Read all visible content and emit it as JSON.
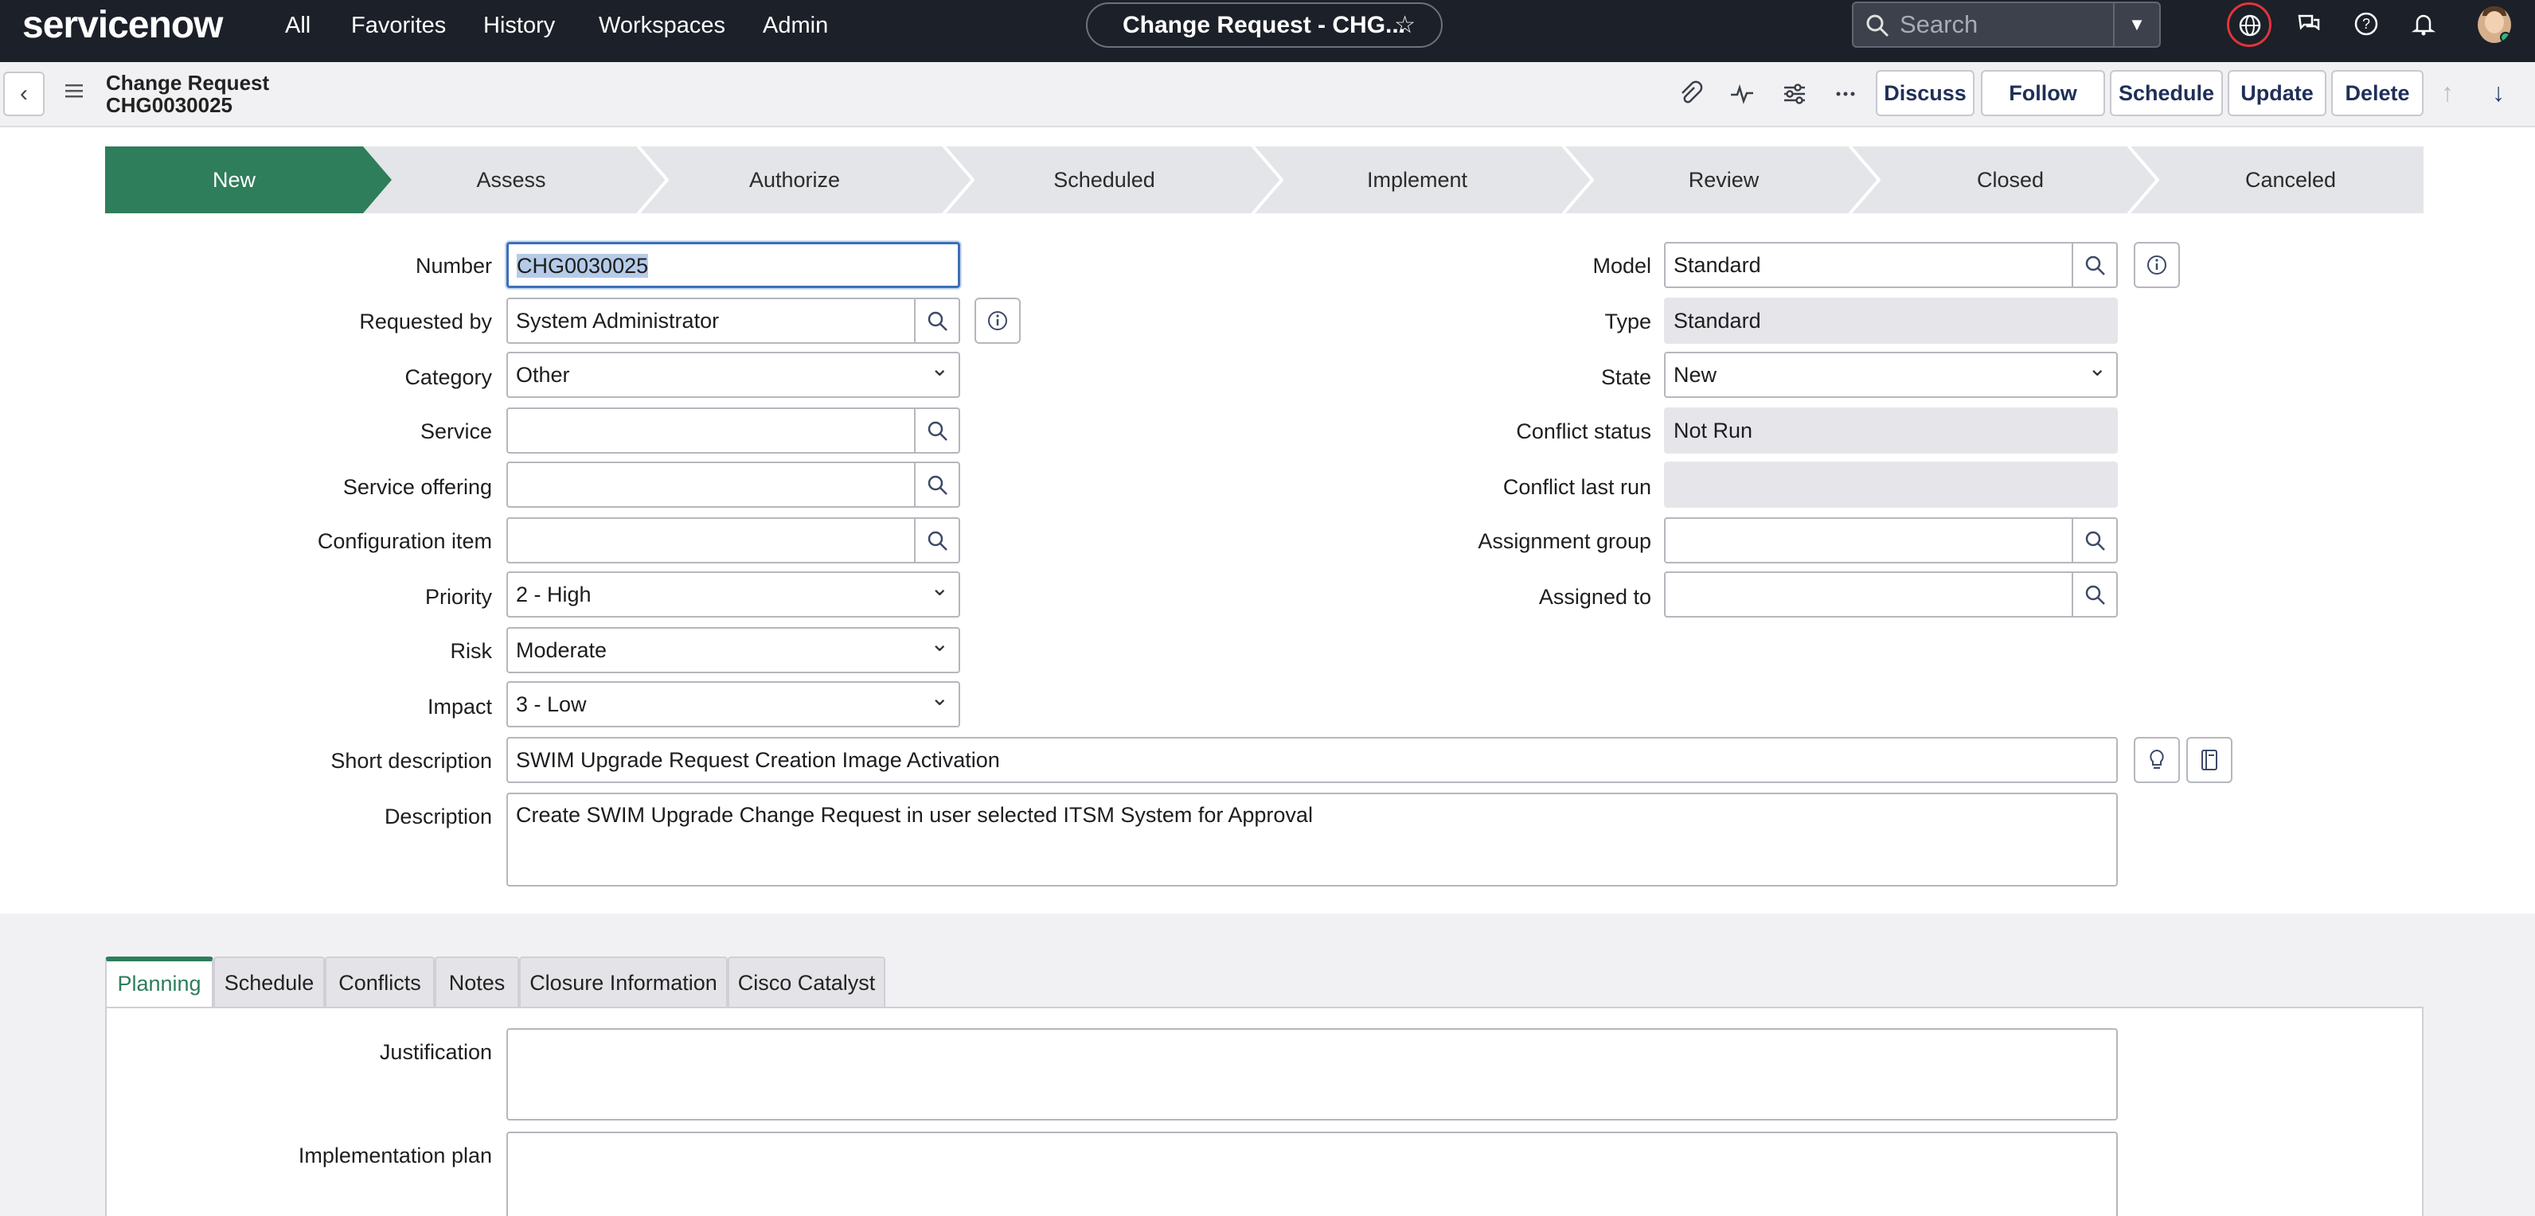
{
  "nav": {
    "logo": "servicenow",
    "links": [
      "All",
      "Favorites",
      "History",
      "Workspaces",
      "Admin"
    ],
    "record_title": "Change Request - CHG...",
    "search_placeholder": "Search"
  },
  "header": {
    "title_line1": "Change Request",
    "title_line2": "CHG0030025",
    "buttons": [
      "Discuss",
      "Follow",
      "Schedule",
      "Update",
      "Delete"
    ]
  },
  "flow": {
    "stages": [
      "New",
      "Assess",
      "Authorize",
      "Scheduled",
      "Implement",
      "Review",
      "Closed",
      "Canceled"
    ],
    "active": "New"
  },
  "fields": {
    "number": {
      "label": "Number",
      "value": "CHG0030025"
    },
    "requested_by": {
      "label": "Requested by",
      "value": "System Administrator"
    },
    "category": {
      "label": "Category",
      "value": "Other"
    },
    "service": {
      "label": "Service",
      "value": ""
    },
    "service_offering": {
      "label": "Service offering",
      "value": ""
    },
    "configuration_item": {
      "label": "Configuration item",
      "value": ""
    },
    "priority": {
      "label": "Priority",
      "value": "2 - High"
    },
    "risk": {
      "label": "Risk",
      "value": "Moderate"
    },
    "impact": {
      "label": "Impact",
      "value": "3 - Low"
    },
    "model": {
      "label": "Model",
      "value": "Standard"
    },
    "type": {
      "label": "Type",
      "value": "Standard"
    },
    "state": {
      "label": "State",
      "value": "New"
    },
    "conflict_status": {
      "label": "Conflict status",
      "value": "Not Run"
    },
    "conflict_last_run": {
      "label": "Conflict last run",
      "value": ""
    },
    "assignment_group": {
      "label": "Assignment group",
      "value": ""
    },
    "assigned_to": {
      "label": "Assigned to",
      "value": ""
    },
    "short_description": {
      "label": "Short description",
      "value": "SWIM Upgrade Request Creation Image Activation"
    },
    "description": {
      "label": "Description",
      "value": "Create SWIM Upgrade Change Request in user selected ITSM System for Approval"
    }
  },
  "tabs": {
    "items": [
      "Planning",
      "Schedule",
      "Conflicts",
      "Notes",
      "Closure Information",
      "Cisco Catalyst"
    ],
    "active": "Planning"
  },
  "planning": {
    "justification": {
      "label": "Justification",
      "value": ""
    },
    "implementation_plan": {
      "label": "Implementation plan",
      "value": ""
    }
  },
  "colors": {
    "nav_bg": "#1c2028",
    "active_stage": "#2e7d5b",
    "button_text": "#1f2f57",
    "focus_border": "#3c6fb8",
    "globe_ring": "#e0343c"
  }
}
